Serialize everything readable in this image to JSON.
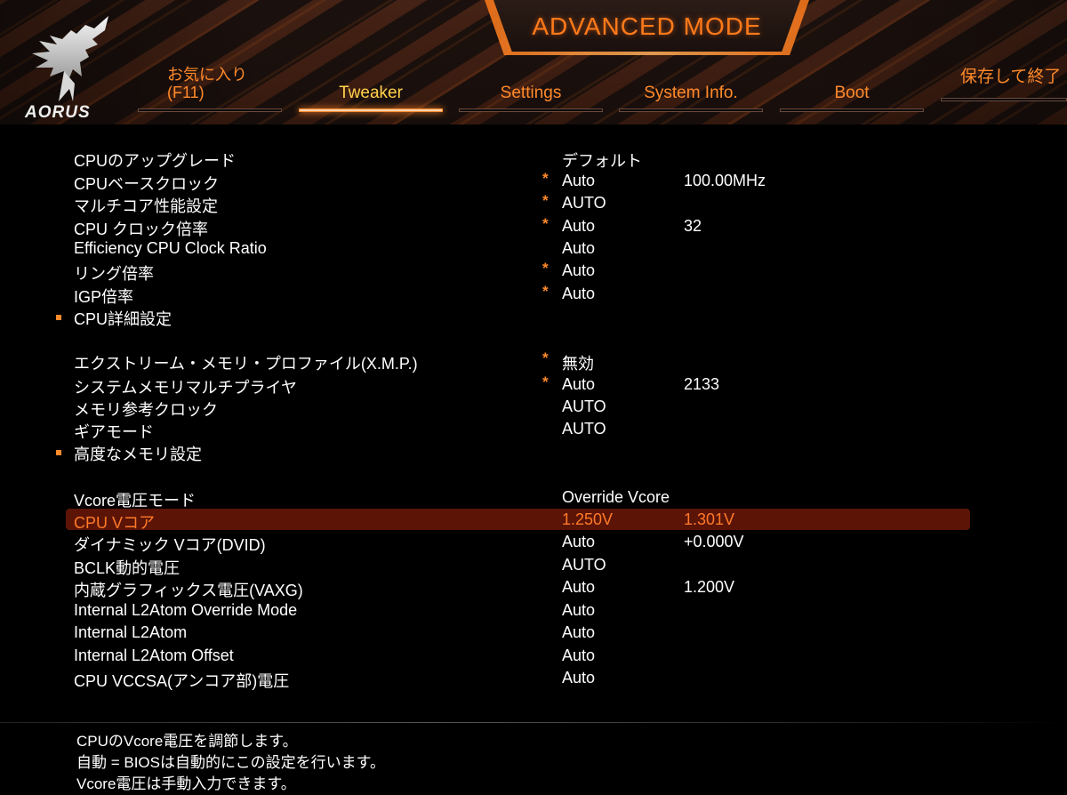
{
  "header": {
    "mode_title": "ADVANCED MODE",
    "logo_text": "AORUS",
    "tabs": [
      {
        "id": "favorites",
        "line1": "お気に入り",
        "line2": "(F11)"
      },
      {
        "id": "tweaker",
        "label": "Tweaker",
        "active": true
      },
      {
        "id": "settings",
        "label": "Settings"
      },
      {
        "id": "system-info",
        "label": "System Info."
      },
      {
        "id": "boot",
        "label": "Boot"
      },
      {
        "id": "save-exit",
        "label": "保存して終了"
      }
    ]
  },
  "settings": {
    "rows": [
      {
        "name": "CPUのアップグレード",
        "star": "",
        "value1": "デフォルト",
        "value2": ""
      },
      {
        "name": "CPUベースクロック",
        "star": "*",
        "value1": "Auto",
        "value2": "100.00MHz"
      },
      {
        "name": "マルチコア性能設定",
        "star": "*",
        "value1": "AUTO",
        "value2": ""
      },
      {
        "name": "CPU クロック倍率",
        "star": "*",
        "value1": "Auto",
        "value2": "32"
      },
      {
        "name": "Efficiency CPU Clock Ratio",
        "star": "",
        "value1": "Auto",
        "value2": ""
      },
      {
        "name": "リング倍率",
        "star": "*",
        "value1": "Auto",
        "value2": ""
      },
      {
        "name": "IGP倍率",
        "star": "*",
        "value1": "Auto",
        "value2": ""
      },
      {
        "name": "CPU詳細設定",
        "bullet": true
      },
      {
        "name": "エクストリーム・メモリ・プロファイル(X.M.P.)",
        "star": "*",
        "value1": "無効",
        "value2": ""
      },
      {
        "name": "システムメモリマルチプライヤ",
        "star": "*",
        "value1": "Auto",
        "value2": "2133"
      },
      {
        "name": "メモリ参考クロック",
        "star": "",
        "value1": "AUTO",
        "value2": ""
      },
      {
        "name": "ギアモード",
        "star": "",
        "value1": "AUTO",
        "value2": ""
      },
      {
        "name": "高度なメモリ設定",
        "bullet": true
      },
      {
        "name": "Vcore電圧モード",
        "star": "",
        "value1": "Override Vcore",
        "value2": ""
      },
      {
        "name": "CPU Vコア",
        "star": "",
        "value1": "1.250V",
        "value2": "1.301V",
        "selected": true
      },
      {
        "name": "ダイナミック Vコア(DVID)",
        "star": "",
        "value1": "Auto",
        "value2": "+0.000V"
      },
      {
        "name": "BCLK動的電圧",
        "star": "",
        "value1": "AUTO",
        "value2": ""
      },
      {
        "name": "内蔵グラフィックス電圧(VAXG)",
        "star": "",
        "value1": "Auto",
        "value2": "1.200V"
      },
      {
        "name": "Internal L2Atom Override Mode",
        "star": "",
        "value1": "Auto",
        "value2": ""
      },
      {
        "name": "Internal L2Atom",
        "star": "",
        "value1": "Auto",
        "value2": ""
      },
      {
        "name": "Internal L2Atom Offset",
        "star": "",
        "value1": "Auto",
        "value2": ""
      },
      {
        "name": "CPU VCCSA(アンコア部)電圧",
        "star": "",
        "value1": "Auto",
        "value2": ""
      }
    ]
  },
  "help": {
    "lines": [
      "CPUのVcore電圧を調節します。",
      "自動 = BIOSは自動的にこの設定を行います。",
      "Vcore電圧は手動入力できます。"
    ]
  },
  "colors": {
    "accent": "#ff8a2a",
    "active_tab": "#ffd24a",
    "selection_bg": "#5b1406",
    "selection_text": "#ff7a2a"
  }
}
